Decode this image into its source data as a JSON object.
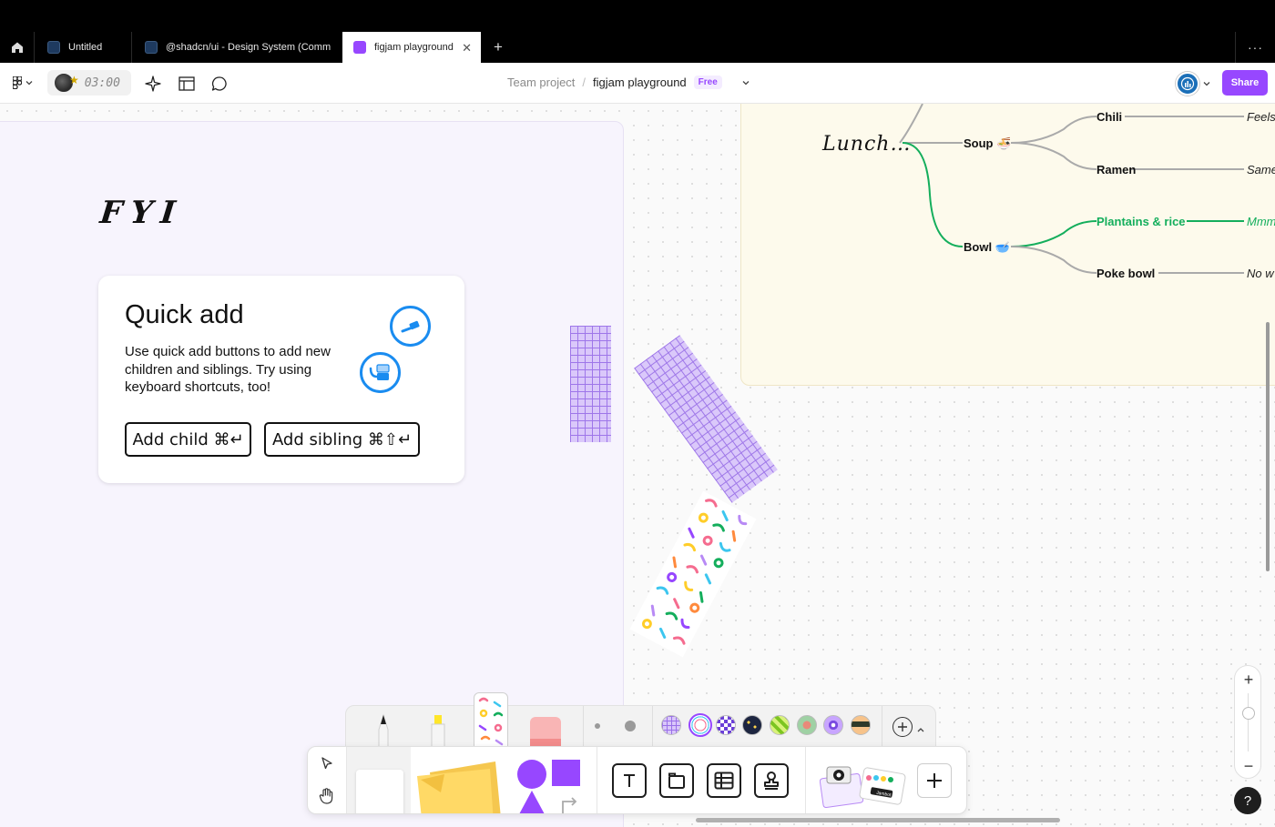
{
  "tabs": {
    "home_icon": "home-icon",
    "items": [
      {
        "label": "Untitled"
      },
      {
        "label": "@shadcn/ui - Design System (Comm"
      },
      {
        "label": "figjam playground",
        "active": true
      }
    ],
    "close_glyph": "✕",
    "new_glyph": "+",
    "more_glyph": "···"
  },
  "toolbar": {
    "timer": "03:00",
    "breadcrumb_team": "Team project",
    "breadcrumb_sep": "/",
    "file_name": "figjam playground",
    "plan_badge": "Free",
    "share_label": "Share"
  },
  "canvas": {
    "fyi": "FYI",
    "quick_add": {
      "title": "Quick add",
      "body": "Use quick add buttons to add new children and siblings. Try using keyboard shortcuts, too!",
      "add_child": "Add child ⌘↵",
      "add_sibling": "Add sibling ⌘⇧↵"
    },
    "mindmap": {
      "root": "Lunch…",
      "soup": "Soup",
      "chili": "Chili",
      "ramen": "Ramen",
      "bowl": "Bowl",
      "plantains": "Plantains & rice",
      "poke": "Poke bowl",
      "chili_note": "Feels",
      "ramen_note": "Same",
      "plantains_note": "Mmm",
      "poke_note": "No w"
    }
  },
  "drawer": {
    "widgets_label": "Jambot"
  },
  "zoom": {
    "in": "+",
    "out": "−",
    "help": "?"
  },
  "colors": {
    "accent": "#9747ff",
    "blue_icon": "#1a8cf0",
    "green_branch": "#14ae5c"
  }
}
